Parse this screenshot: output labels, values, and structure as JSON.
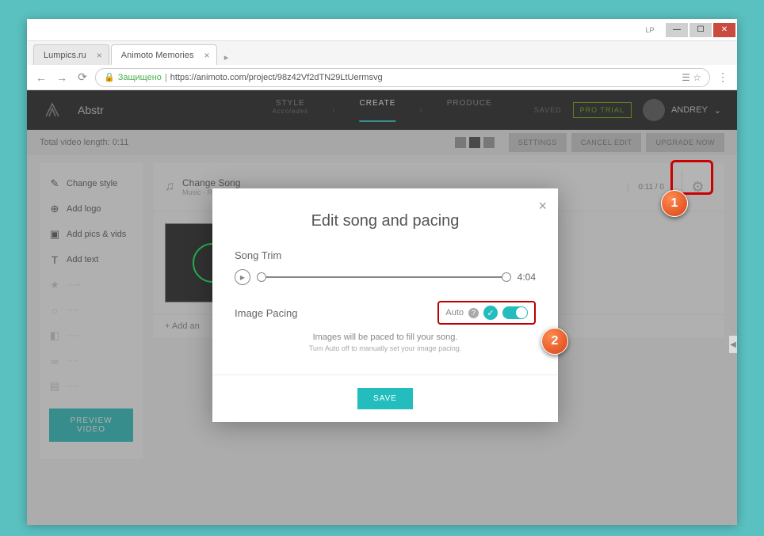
{
  "titlebar": {
    "lp": "LP"
  },
  "tabs": {
    "tab1": "Lumpics.ru",
    "tab2": "Animoto Memories"
  },
  "addr": {
    "secure": "Защищено",
    "url": "https://animoto.com/project/98z42Vf2dTN29LtUermsvg"
  },
  "topbar": {
    "project": "Abstr",
    "step1": "STYLE",
    "step1sub": "Accolades",
    "step2": "CREATE",
    "step3": "PRODUCE",
    "saved": "SAVED",
    "trial": "PRO TRIAL",
    "user": "ANDREY"
  },
  "toolbar": {
    "length": "Total video length: 0:11",
    "settings": "SETTINGS",
    "cancel": "CANCEL EDIT",
    "upgrade": "UPGRADE NOW"
  },
  "sidebar": {
    "items": [
      {
        "label": "Change style"
      },
      {
        "label": "Add logo"
      },
      {
        "label": "Add pics & vids"
      },
      {
        "label": "Add text"
      }
    ],
    "preview": "PREVIEW VIDEO"
  },
  "song": {
    "title": "Change Song",
    "sub": "Music · Roxy",
    "time": "0:11 / 0"
  },
  "addbtn": "+ Add an",
  "modal": {
    "title": "Edit song and pacing",
    "trim_label": "Song Trim",
    "duration": "4:04",
    "pacing_label": "Image Pacing",
    "auto": "Auto",
    "desc": "Images will be paced to fill your song.",
    "hint": "Turn Auto off to manually set your image pacing.",
    "save": "SAVE"
  },
  "callouts": {
    "c1": "1",
    "c2": "2"
  }
}
